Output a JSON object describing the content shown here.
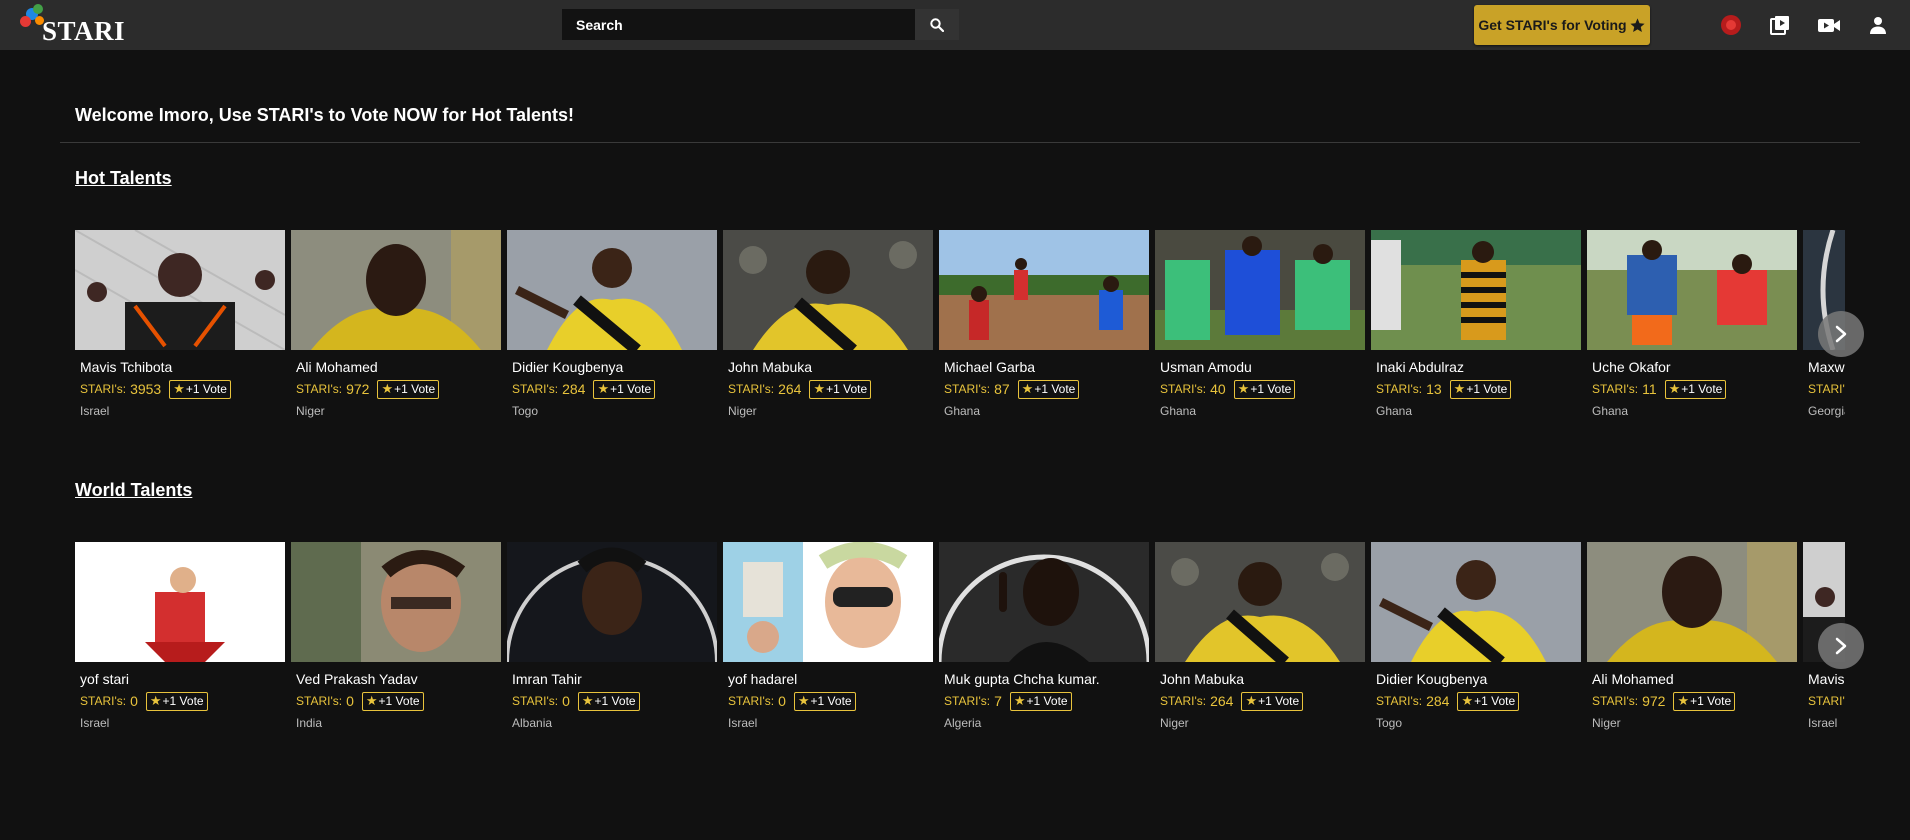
{
  "header": {
    "logo_text": "STARI",
    "search_placeholder": "Search",
    "get_button_label": "Get STARI's for Voting",
    "icons": [
      "search-icon",
      "star-icon",
      "live-record-icon",
      "video-library-icon",
      "video-camera-icon",
      "user-icon"
    ],
    "accent_color": "#c9a227"
  },
  "welcome_text": "Welcome Imoro, Use STARI's to Vote NOW for Hot Talents!",
  "sections": [
    {
      "title": "Hot Talents",
      "talents": [
        {
          "name": "Mavis Tchibota",
          "stari_label": "STARI's:",
          "stari": "3953",
          "vote_label": "+1 Vote",
          "country": "Israel"
        },
        {
          "name": "Ali Mohamed",
          "stari_label": "STARI's:",
          "stari": "972",
          "vote_label": "+1 Vote",
          "country": "Niger"
        },
        {
          "name": "Didier Kougbenya",
          "stari_label": "STARI's:",
          "stari": "284",
          "vote_label": "+1 Vote",
          "country": "Togo"
        },
        {
          "name": "John Mabuka",
          "stari_label": "STARI's:",
          "stari": "264",
          "vote_label": "+1 Vote",
          "country": "Niger"
        },
        {
          "name": "Michael Garba",
          "stari_label": "STARI's:",
          "stari": "87",
          "vote_label": "+1 Vote",
          "country": "Ghana"
        },
        {
          "name": "Usman Amodu",
          "stari_label": "STARI's:",
          "stari": "40",
          "vote_label": "+1 Vote",
          "country": "Ghana"
        },
        {
          "name": "Inaki Abdulraz",
          "stari_label": "STARI's:",
          "stari": "13",
          "vote_label": "+1 Vote",
          "country": "Ghana"
        },
        {
          "name": "Uche Okafor",
          "stari_label": "STARI's:",
          "stari": "11",
          "vote_label": "+1 Vote",
          "country": "Ghana"
        },
        {
          "name": "Maxwe",
          "stari_label": "STARI's:",
          "stari": "",
          "vote_label": "",
          "country": "Georgia"
        }
      ]
    },
    {
      "title": "World Talents",
      "talents": [
        {
          "name": "yof stari",
          "stari_label": "STARI's:",
          "stari": "0",
          "vote_label": "+1 Vote",
          "country": "Israel"
        },
        {
          "name": "Ved Prakash Yadav",
          "stari_label": "STARI's:",
          "stari": "0",
          "vote_label": "+1 Vote",
          "country": "India"
        },
        {
          "name": "Imran Tahir",
          "stari_label": "STARI's:",
          "stari": "0",
          "vote_label": "+1 Vote",
          "country": "Albania"
        },
        {
          "name": "yof hadarel",
          "stari_label": "STARI's:",
          "stari": "0",
          "vote_label": "+1 Vote",
          "country": "Israel"
        },
        {
          "name": "Muk gupta Chcha kumar.",
          "stari_label": "STARI's:",
          "stari": "7",
          "vote_label": "+1 Vote",
          "country": "Algeria"
        },
        {
          "name": "John Mabuka",
          "stari_label": "STARI's:",
          "stari": "264",
          "vote_label": "+1 Vote",
          "country": "Niger"
        },
        {
          "name": "Didier Kougbenya",
          "stari_label": "STARI's:",
          "stari": "284",
          "vote_label": "+1 Vote",
          "country": "Togo"
        },
        {
          "name": "Ali Mohamed",
          "stari_label": "STARI's:",
          "stari": "972",
          "vote_label": "+1 Vote",
          "country": "Niger"
        },
        {
          "name": "Mavis T",
          "stari_label": "STARI's:",
          "stari": "",
          "vote_label": "",
          "country": "Israel"
        }
      ]
    }
  ]
}
